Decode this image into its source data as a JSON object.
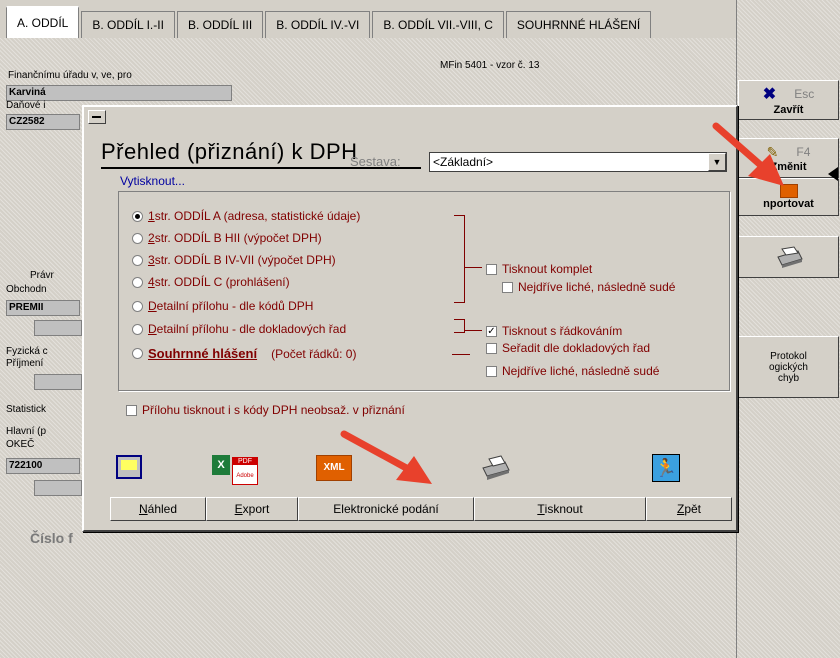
{
  "tabs": [
    "A. ODDÍL",
    "B. ODDÍL I.-II",
    "B. ODDÍL III",
    "B. ODDÍL IV.-VI",
    "B. ODDÍL VII.-VIII, C",
    "SOUHRNNÉ HLÁŠENÍ"
  ],
  "form": {
    "mfin": "MFin 5401 - vzor č. 13",
    "office_label": "Finančnímu úřadu v, ve, pro",
    "office_value": "Karviná",
    "dic_label": "Daňové i",
    "dic_value": "CZ2582",
    "pravni_label": "Právr",
    "obchod_label": "Obchodn",
    "obchod_value": "PREMII",
    "fyzicka_label": "Fyzická c",
    "prijmeni_label": "Příjmení",
    "statistika_label": "Statistick",
    "hlavni_label": "Hlavní (p",
    "okec_label": "OKEČ",
    "okec_value": "722100",
    "cislo_text": "Číslo f"
  },
  "right_panel": {
    "esc_key": "Esc",
    "esc_label": "Zavřít",
    "f4_key": "F4",
    "f4_label": "Změnit",
    "import_label": "nportovat",
    "protokol_label": "Protokol ogických chyb"
  },
  "dialog": {
    "title": "Přehled (přiznání) k DPH",
    "sestava_label": "Sestava:",
    "sestava_value": "<Základní>",
    "vytisknout": "Vytisknout...",
    "radios": [
      {
        "key": "1",
        "text": " str. ODDÍL A (adresa, statistické údaje)",
        "selected": true
      },
      {
        "key": "2",
        "text": " str. ODDÍL B HII (výpočet DPH)",
        "selected": false
      },
      {
        "key": "3",
        "text": " str. ODDÍL B IV-VII (výpočet DPH)",
        "selected": false
      },
      {
        "key": "4",
        "text": " str. ODDÍL C (prohlášení)",
        "selected": false
      },
      {
        "key": "D",
        "text": "etailní přílohu - dle kódů DPH",
        "selected": false
      },
      {
        "key": "D",
        "text": "etailní přílohu - dle dokladových řad",
        "selected": false
      }
    ],
    "souhrn_label": "Souhrnné hlášení",
    "souhrn_count": "(Počet řádků: 0)",
    "checks": [
      {
        "label": "Tisknout komplet",
        "checked": false
      },
      {
        "label": "Nejdříve liché, následně sudé",
        "checked": false
      },
      {
        "label": "Tisknout s řádkováním",
        "checked": true
      },
      {
        "label": "Seřadit dle dokladových řad",
        "checked": false
      },
      {
        "label": "Nejdříve liché, následně sudé",
        "checked": false
      }
    ],
    "prilohu_check": "Přílohu tisknout i s kódy DPH neobsaž. v přiznání",
    "xml_icon": "XML",
    "pdf_icon": "PDF",
    "adobe_icon": "Adobe",
    "buttons": [
      {
        "key": "N",
        "rest": "áhled"
      },
      {
        "key": "E",
        "rest": "xport"
      },
      {
        "key": "",
        "rest": "Elektronické podání"
      },
      {
        "key": "T",
        "rest": "isknout"
      },
      {
        "key": "Z",
        "rest": "pět"
      }
    ]
  },
  "colors": {
    "accent_red": "#800000",
    "arrow_red": "#e8412c",
    "link_blue": "#0000a0"
  }
}
